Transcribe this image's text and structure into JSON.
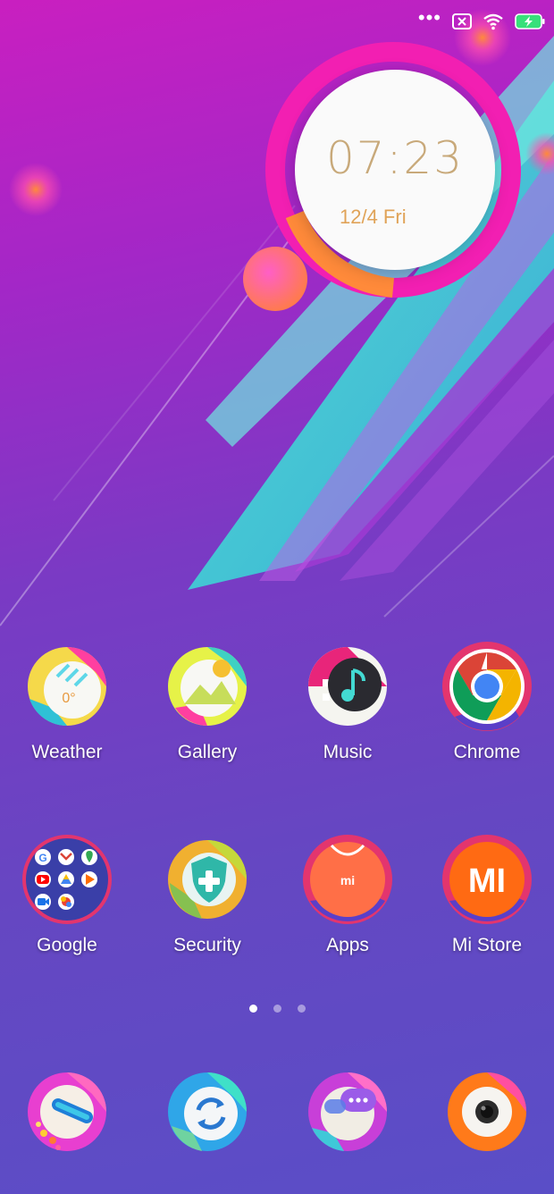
{
  "status_bar": {
    "overflow": "•••",
    "icons": [
      "sim-off-icon",
      "wifi-icon",
      "battery-charging-icon"
    ]
  },
  "clock_widget": {
    "time": "07:23",
    "date": "12/4 Fri"
  },
  "home_apps": [
    {
      "label": "Weather",
      "icon": "weather-icon",
      "badge_text": "0°"
    },
    {
      "label": "Gallery",
      "icon": "gallery-icon"
    },
    {
      "label": "Music",
      "icon": "music-icon"
    },
    {
      "label": "Chrome",
      "icon": "chrome-icon"
    },
    {
      "label": "Google",
      "icon": "google-folder-icon"
    },
    {
      "label": "Security",
      "icon": "security-icon"
    },
    {
      "label": "Apps",
      "icon": "apps-store-icon",
      "badge_text": "mi"
    },
    {
      "label": "Mi Store",
      "icon": "mi-store-icon",
      "badge_text": "MI"
    }
  ],
  "page_indicator": {
    "pages": 3,
    "active": 0
  },
  "dock": [
    {
      "icon": "phone-icon"
    },
    {
      "icon": "sync-browser-icon"
    },
    {
      "icon": "messages-icon"
    },
    {
      "icon": "camera-icon"
    }
  ],
  "colors": {
    "clock_time": "#c8a97a",
    "clock_date": "#e0a358",
    "accent_pink": "#f21fb2",
    "accent_cyan": "#45e6cf"
  }
}
